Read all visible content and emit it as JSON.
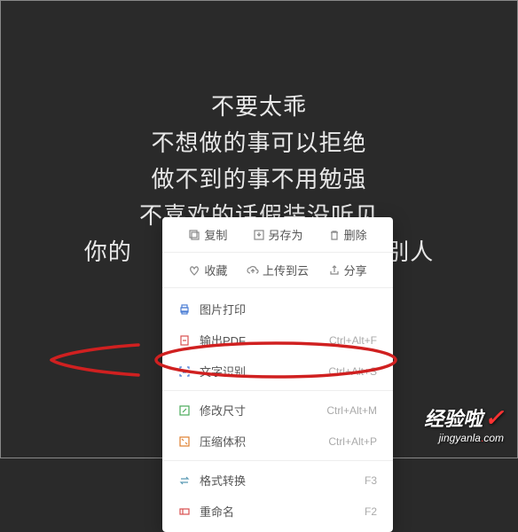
{
  "background": {
    "line1": "不要太乖",
    "line2": "不想做的事可以拒绝",
    "line3": "做不到的事不用勉强",
    "line4": "不喜欢的话假装没听见",
    "line5_left": "你的",
    "line5_right": "别人"
  },
  "menu": {
    "top": {
      "copy": "复制",
      "saveAs": "另存为",
      "delete": "删除"
    },
    "second": {
      "favorite": "收藏",
      "upload": "上传到云",
      "share": "分享"
    },
    "items": [
      {
        "label": "图片打印",
        "shortcut": ""
      },
      {
        "label": "输出PDF",
        "shortcut": "Ctrl+Alt+F"
      },
      {
        "label": "文字识别",
        "shortcut": "Ctrl+Alt+S"
      },
      {
        "label": "修改尺寸",
        "shortcut": "Ctrl+Alt+M"
      },
      {
        "label": "压缩体积",
        "shortcut": "Ctrl+Alt+P"
      },
      {
        "label": "格式转换",
        "shortcut": "F3"
      },
      {
        "label": "重命名",
        "shortcut": "F2"
      }
    ]
  },
  "watermark": {
    "title": "经验啦",
    "url_part1": "jingyanla",
    "url_part2": "com"
  }
}
